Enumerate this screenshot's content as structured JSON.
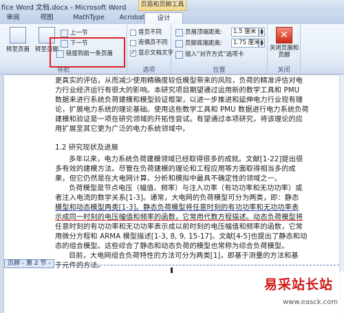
{
  "window": {
    "title": "fice Word 文档.docx - Microsoft Word",
    "context_title": "页眉和页脚工具"
  },
  "tabs": [
    "审阅",
    "视图",
    "MathType",
    "Acrobat",
    "设计"
  ],
  "ribbon": {
    "nav": {
      "label": "导航",
      "goto_header": "转至页眉",
      "goto_footer": "转至页脚",
      "prev": "上一节",
      "next": "下一节",
      "link_prev": "链接到前一条页眉"
    },
    "options": {
      "label": "选项",
      "first_page_diff": "首页不同",
      "odd_even_diff": "奇偶页不同",
      "show_doc_text": "显示文档文字"
    },
    "position": {
      "label": "位置",
      "header_dist_label": "页眉顶端距离:",
      "header_dist_value": "1.5 厘米",
      "footer_dist_label": "页脚底端距离:",
      "footer_dist_value": "1.75 厘米",
      "insert_tab": "插入“对齐方式”选项卡"
    },
    "close": {
      "label": "关闭",
      "close_button": "关闭页眉和页脚"
    }
  },
  "document": {
    "lines": [
      "更真实的评估，从而减少使用精确度较低模型带来的风险，负荷的精准评估对电",
      "力行业经济运行有很大的影响。本研究项目期望通过运用新的数学工具和 PMU",
      "数据来进行系统负荷建模和模型验证框架，以进一步推进和延伸电力行业现有理",
      "论，扩展电力系统的理论基础。使用这些数学工具和 PMU 数据进行电力系统负荷",
      "建模和验证是一项在研究领域的开拓性尝试。有望通过本项研究，将该理论的应",
      "用扩展至其它更为广泛的电力系统领域中。",
      "",
      "1.2 研究现状及进展",
      "多年以来，电力系统负荷建模领域已经取得很多的成就。文献[1-22]提出很",
      "多有效的建模方法。尽管在负荷建模的理论和工程应用等方面取得相当多的成",
      "果，但它仍然是在大电网计算、分析和模拟中最具不确定性的领域之一。",
      "负荷模型是节点电压（幅值、频率）与注入功率（有功功率和无功功率）或",
      "者注入电流的数学关系[1-3]。通常，大电网的负荷模型可分为两类，即：静态",
      "模型和动态模型两类[1-3]。静态负荷模型将任意时刻的有功功率和无功功率表",
      "示成同一时刻的电压幅值和频率的函数，它常用代数方程描述。动态负荷模型将",
      "任意时刻的有功功率和无功功率表示成以前时刻的电压幅值和频率的函数，它常",
      "用微分方程和 ARMA 模型描述[1-3, 8, 9, 15-17]。文献[4-5]也提出了静态和动",
      "态的组合模型。这些综合了静态和动态负荷的模型也常称为综合负荷模型。",
      "目前，大电网组合负荷特性的方法可分为两类[1]，即基于测量的方法和基",
      "于元件的方法。"
    ],
    "footer_label": "页脚 - 第 2 节 -"
  },
  "watermark": {
    "name": "易采站长站",
    "url": "www.easck.com"
  },
  "colors": {
    "highlight_border": "#e02020",
    "watermark_red": "#d01616",
    "ribbon_bg": "#e3ecf8"
  }
}
